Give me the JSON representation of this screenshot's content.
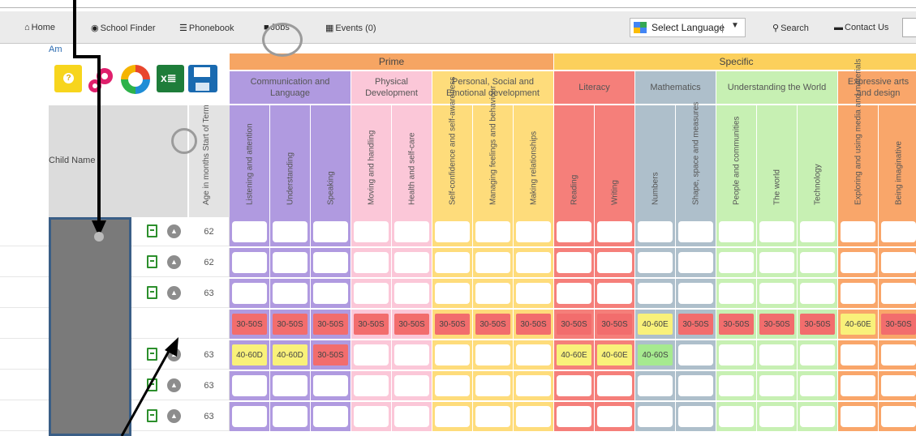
{
  "nav": {
    "items": [
      {
        "label": "Home",
        "icon": "home-icon",
        "glyph": "⌂"
      },
      {
        "label": "School Finder",
        "icon": "eye-icon",
        "glyph": "◉"
      },
      {
        "label": "Phonebook",
        "icon": "list-icon",
        "glyph": "☰"
      },
      {
        "label": "Jobs",
        "icon": "briefcase-icon",
        "glyph": "■"
      },
      {
        "label": "Events (0)",
        "icon": "calendar-icon",
        "glyph": "▦"
      },
      {
        "label": "Search",
        "icon": "search-icon",
        "glyph": "⚲"
      },
      {
        "label": "Contact Us",
        "icon": "speech-bubble-icon",
        "glyph": "▬"
      }
    ],
    "language_label": "Select Language",
    "language_arrow": "▼",
    "partial_label": "Am"
  },
  "toolbar": {
    "help_glyph": "?",
    "excel_glyph": "x≣"
  },
  "headers": {
    "bands": [
      {
        "label": "Prime",
        "color": "#f6a563"
      },
      {
        "label": "Specific",
        "color": "#fcd05c"
      }
    ],
    "areas": [
      {
        "label": "Communication and Language",
        "color": "#b09ae0",
        "cols": 3
      },
      {
        "label": "Physical Development",
        "color": "#fbc7d8",
        "cols": 2
      },
      {
        "label": "Personal, Social and Emotional development",
        "color": "#fedc7b",
        "cols": 3
      },
      {
        "label": "Literacy",
        "color": "#f57f7a",
        "cols": 2
      },
      {
        "label": "Mathematics",
        "color": "#aebfcb",
        "cols": 2
      },
      {
        "label": "Understanding the World",
        "color": "#c7f0b3",
        "cols": 3
      },
      {
        "label": "Expressive arts and design",
        "color": "#f9a66a",
        "cols": 2
      }
    ],
    "aspects": [
      "Listening and attention",
      "Understanding",
      "Speaking",
      "Moving and handling",
      "Health and self-care",
      "Self-confidence and self-awareness",
      "Managing feelings and behaviour",
      "Making relationships",
      "Reading",
      "Writing",
      "Numbers",
      "Shape, space and measures",
      "People and communities",
      "The world",
      "Technology",
      "Exploring and using media and materials",
      "Being imaginative"
    ],
    "child_name": "Child Name",
    "age_label": "Age in months Start of Term"
  },
  "rows": [
    {
      "age": "62",
      "icons": true,
      "cells": []
    },
    {
      "age": "62",
      "icons": true,
      "cells": []
    },
    {
      "age": "63",
      "icons": true,
      "cells": []
    },
    {
      "age": "",
      "icons": false,
      "cells": [
        "30-50S",
        "30-50S",
        "30-50S",
        "30-50S",
        "30-50S",
        "30-50S",
        "30-50S",
        "30-50S",
        "30-50S",
        "30-50S",
        "40-60E",
        "30-50S",
        "30-50S",
        "30-50S",
        "30-50S",
        "40-60E",
        "30-50S"
      ]
    },
    {
      "age": "63",
      "icons": true,
      "cells": [
        "40-60D",
        "40-60D",
        "30-50S",
        "",
        "",
        "",
        "",
        "",
        "40-60E",
        "40-60E",
        "40-60S"
      ]
    },
    {
      "age": "63",
      "icons": true,
      "cells": []
    },
    {
      "age": "63",
      "icons": true,
      "cells": []
    }
  ],
  "cell_colors": {
    "30-50S": "#f26d6d",
    "40-60E": "#f9f17a",
    "40-60D": "#f9f17a",
    "40-60S": "#a6ea8f"
  }
}
